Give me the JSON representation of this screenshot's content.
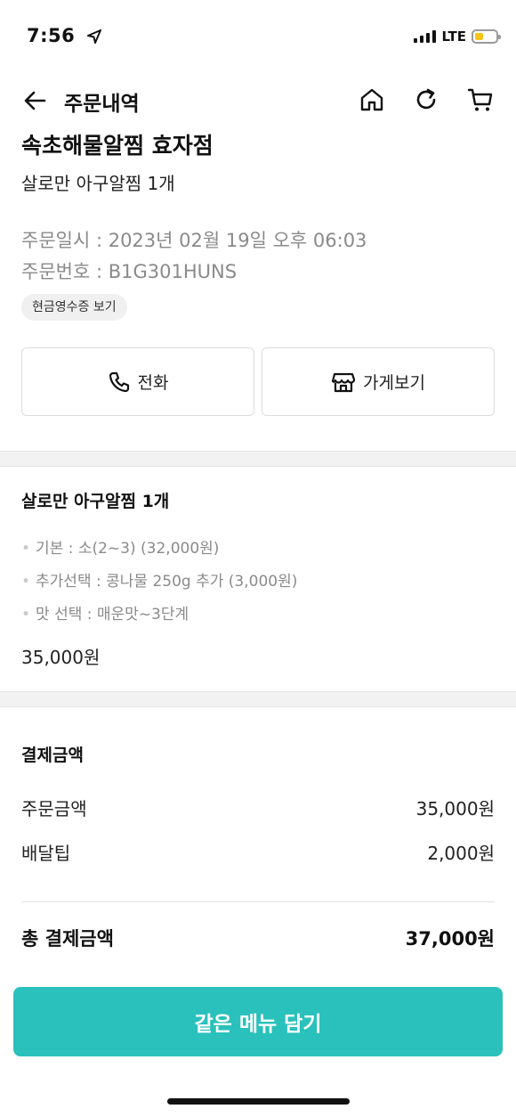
{
  "status_bar": {
    "time": "7:56",
    "network": "LTE",
    "battery_level": 0.4,
    "battery_color": "#f5c518"
  },
  "header": {
    "title": "주문내역",
    "icons": [
      "back-arrow-icon",
      "home-icon",
      "refresh-icon",
      "cart-icon"
    ]
  },
  "store": {
    "name": "속초해물알찜 효자점",
    "summary": "살로만 아구알찜 1개",
    "order_date": "주문일시 : 2023년 02월 19일 오후 06:03",
    "order_number": "주문번호 : B1G301HUNS",
    "receipt_label": "현금영수증 보기",
    "call_label": "전화",
    "store_label": "가게보기"
  },
  "menu": {
    "title": "살로만 아구알찜 1개",
    "options": [
      "기본 : 소(2~3) (32,000원)",
      "추가선택 : 콩나물 250g 추가 (3,000원)",
      "맛 선택 : 매운맛~3단계"
    ],
    "price": "35,000원"
  },
  "payment": {
    "title": "결제금액",
    "rows": [
      {
        "label": "주문금액",
        "value": "35,000원"
      },
      {
        "label": "배달팁",
        "value": "2,000원"
      }
    ],
    "total_label": "총 결제금액",
    "total_value": "37,000원"
  },
  "cta": {
    "label": "같은 메뉴 담기",
    "color": "#2ac1bc"
  }
}
